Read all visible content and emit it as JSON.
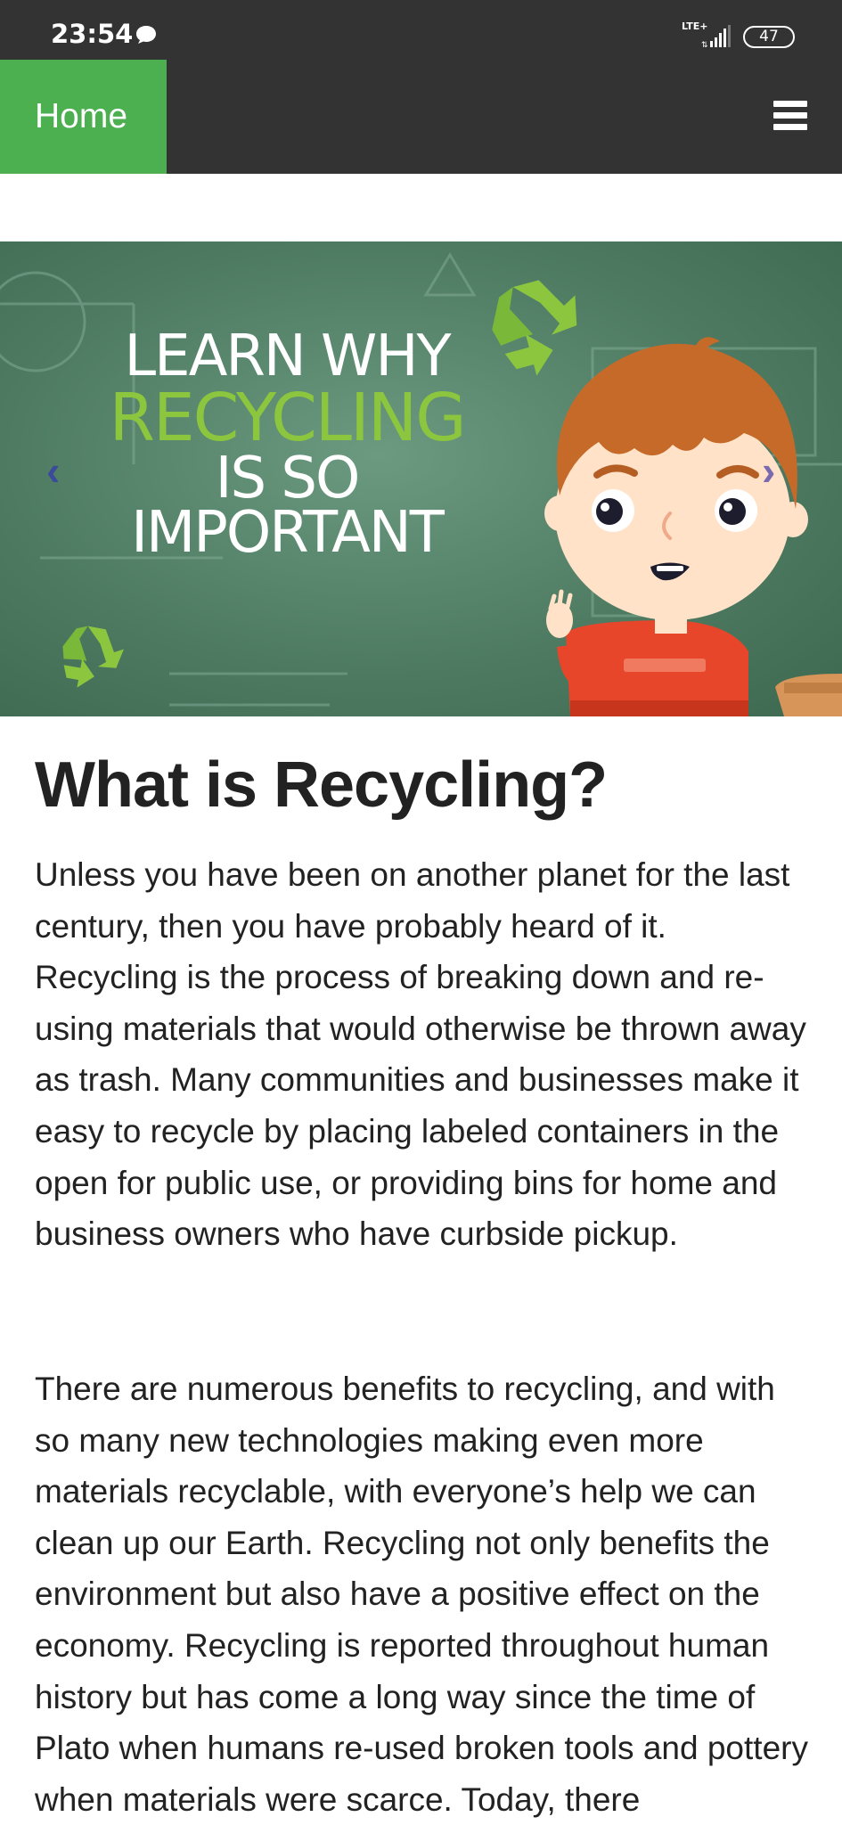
{
  "status_bar": {
    "time": "23:54",
    "network": "LTE+",
    "battery": "47",
    "icons": [
      "message-icon",
      "signal-icon",
      "battery-icon"
    ]
  },
  "nav": {
    "home_label": "Home",
    "menu_icon": "hamburger-menu-icon",
    "home_color": "#4caf50",
    "bar_color": "#333333"
  },
  "hero": {
    "line1": "LEARN WHY",
    "line2": "RECYCLING",
    "line3": "IS SO",
    "line4": "IMPORTANT",
    "prev_icon": "chevron-left-icon",
    "next_icon": "chevron-right-icon",
    "prev_glyph": "‹",
    "next_glyph": "›",
    "accent_color": "#8cc63f",
    "background_color": "#4d7a61"
  },
  "article": {
    "title": "What is Recycling?",
    "paragraph1": "Unless you have been on another planet for the last century, then you have probably heard of it. Recycling is the process of breaking down and re-using materials that would otherwise be thrown away as trash. Many communities and businesses make it easy to recycle by placing labeled containers in the open for public use, or providing bins for home and business owners who have curbside pickup.",
    "paragraph2": "There are numerous benefits to recycling, and with so many new technologies making even more materials recyclable, with everyone’s help we can clean up our Earth. Recycling not only benefits the environment but also have a positive effect on the economy. Recycling is reported throughout human history but has come a long way since the time of Plato when humans re-used broken tools and pottery when materials were scarce. Today, there"
  }
}
